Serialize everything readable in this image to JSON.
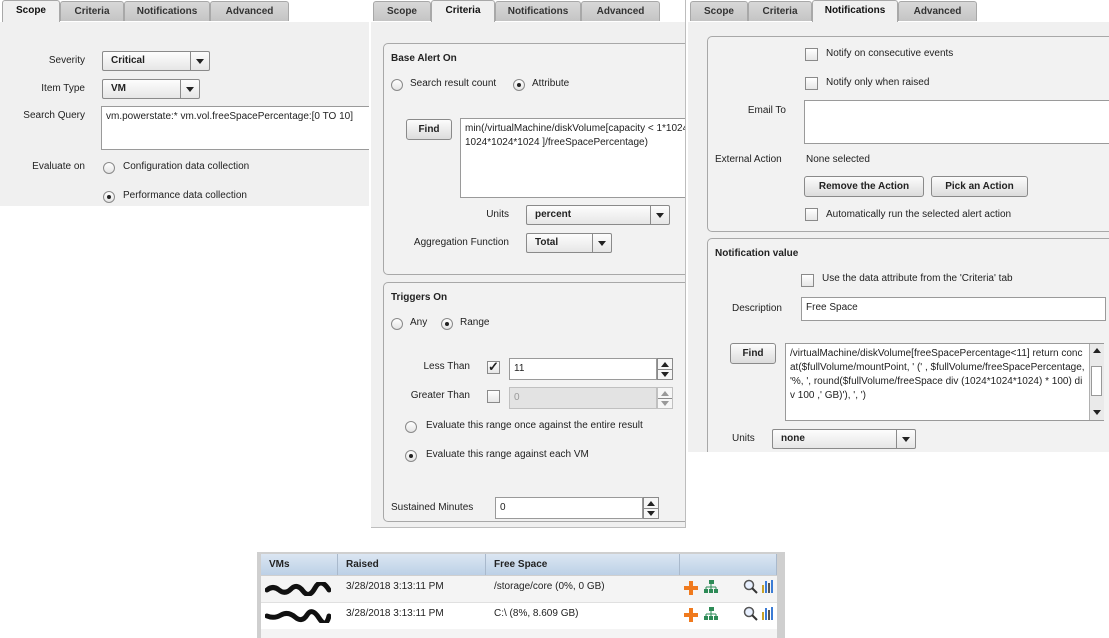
{
  "tabs": [
    "Scope",
    "Criteria",
    "Notifications",
    "Advanced"
  ],
  "scope": {
    "severity_label": "Severity",
    "severity_value": "Critical",
    "item_type_label": "Item Type",
    "item_type_value": "VM",
    "search_query_label": "Search Query",
    "search_query_value": "vm.powerstate:* vm.vol.freeSpacePercentage:[0 TO 10]",
    "evaluate_on_label": "Evaluate on",
    "evaluate_options": [
      "Configuration data collection",
      "Performance data collection"
    ],
    "evaluate_selected": "Performance data collection"
  },
  "criteria": {
    "base_alert_title": "Base Alert On",
    "base_options": [
      "Search result count",
      "Attribute"
    ],
    "base_selected": "Attribute",
    "find_label": "Find",
    "find_expression": "min(/virtualMachine/diskVolume[capacity < 1*1024*1024*1024*1024 ]/freeSpacePercentage)",
    "units_label": "Units",
    "units_value": "percent",
    "aggregation_label": "Aggregation Function",
    "aggregation_value": "Total",
    "triggers_title": "Triggers On",
    "trigger_options": [
      "Any",
      "Range"
    ],
    "trigger_selected": "Range",
    "less_than_label": "Less Than",
    "less_than_checked": true,
    "less_than_value": "11",
    "greater_than_label": "Greater Than",
    "greater_than_checked": false,
    "greater_than_value": "0",
    "range_options": [
      "Evaluate this range once against the entire result",
      "Evaluate this range against each VM"
    ],
    "range_selected": "Evaluate this range against each VM",
    "sustained_label": "Sustained Minutes",
    "sustained_value": "0"
  },
  "notifications": {
    "consecutive_label": "Notify on consecutive events",
    "only_raised_label": "Notify only when raised",
    "email_label": "Email To",
    "email_value": "",
    "external_action_label": "External Action",
    "external_action_value": "None selected",
    "remove_action_label": "Remove the Action",
    "pick_action_label": "Pick an Action",
    "auto_run_label": "Automatically run the selected alert action",
    "notification_value_title": "Notification value",
    "use_criteria_label": "Use the data attribute from the 'Criteria' tab",
    "description_label": "Description",
    "description_value": "Free Space",
    "find_label": "Find",
    "find_expression": "/virtualMachine/diskVolume[freeSpacePercentage<11] return concat($fullVolume/mountPoint, ' (' , $fullVolume/freeSpacePercentage, '%, ', round($fullVolume/freeSpace div (1024*1024*1024) * 100) div 100 ,' GB)'), ', ')",
    "units_label": "Units",
    "units_value": "none"
  },
  "results": {
    "columns": [
      "VMs",
      "Raised",
      "Free Space"
    ],
    "rows": [
      {
        "raised": "3/28/2018 3:13:11 PM",
        "free_space": "/storage/core (0%, 0 GB)"
      },
      {
        "raised": "3/28/2018 3:13:11 PM",
        "free_space": "C:\\ (8%, 8.609 GB)"
      }
    ]
  },
  "colors": {
    "panel_bg": "#f0f0f0",
    "grid_header": "#c8d8ea",
    "add_icon": "#f07a1e",
    "tree_icon": "#2e8b57"
  }
}
